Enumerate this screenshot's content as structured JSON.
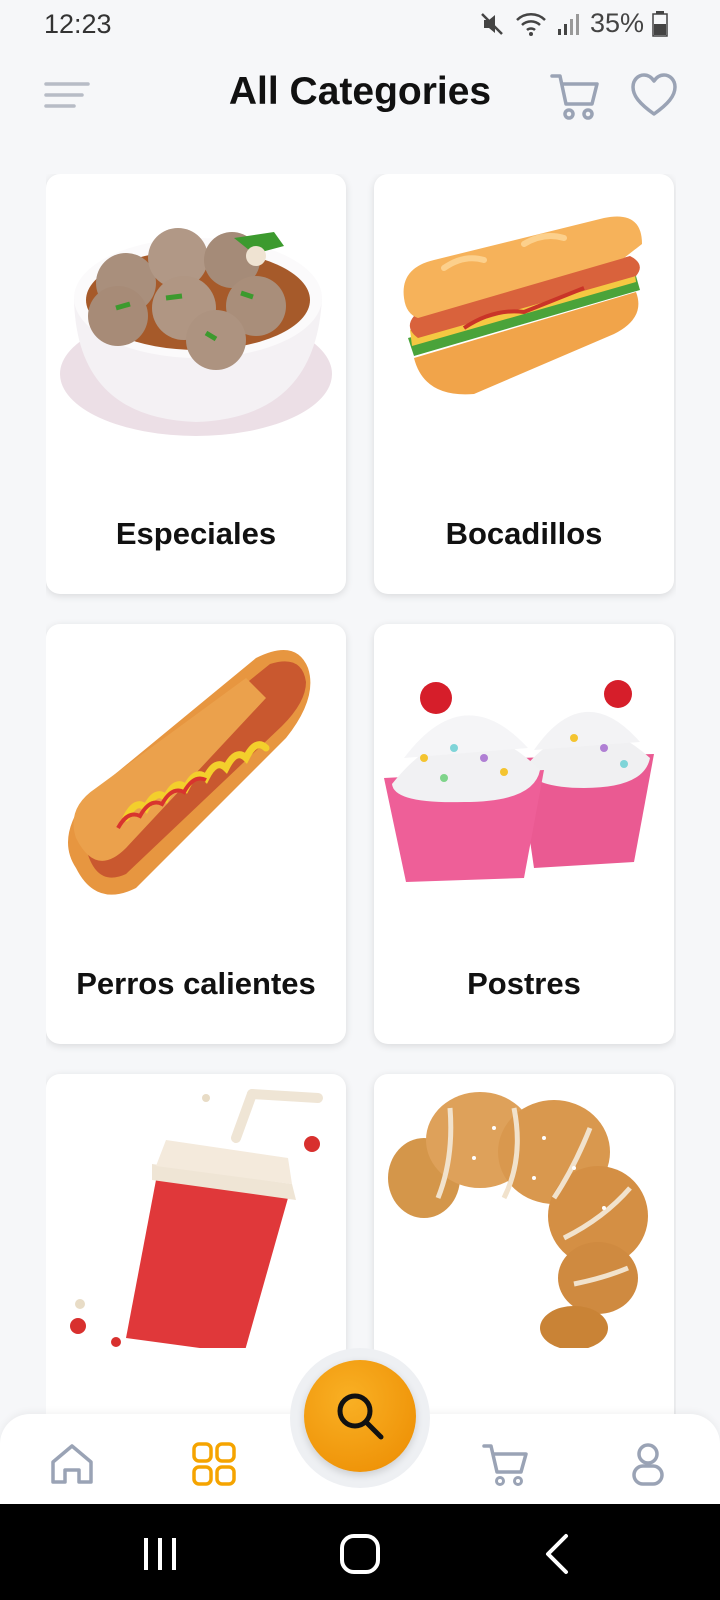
{
  "status_bar": {
    "time": "12:23",
    "battery": "35%"
  },
  "header": {
    "title": "All Categories"
  },
  "categories": [
    {
      "label": "Especiales",
      "image": "meatball-soup-bowl"
    },
    {
      "label": "Bocadillos",
      "image": "sandwich"
    },
    {
      "label": "Perros calientes",
      "image": "hot-dog"
    },
    {
      "label": "Postres",
      "image": "cupcakes"
    },
    {
      "label": "",
      "image": "soda-cup"
    },
    {
      "label": "",
      "image": "croissant"
    }
  ],
  "bottom_nav": {
    "items": [
      "home-icon",
      "categories-icon",
      "search-icon",
      "cart-icon",
      "profile-icon"
    ],
    "active": "categories-icon"
  },
  "colors": {
    "accent": "#f5a400",
    "icon_gray": "#9aa3b5",
    "background": "#f6f7f9"
  }
}
